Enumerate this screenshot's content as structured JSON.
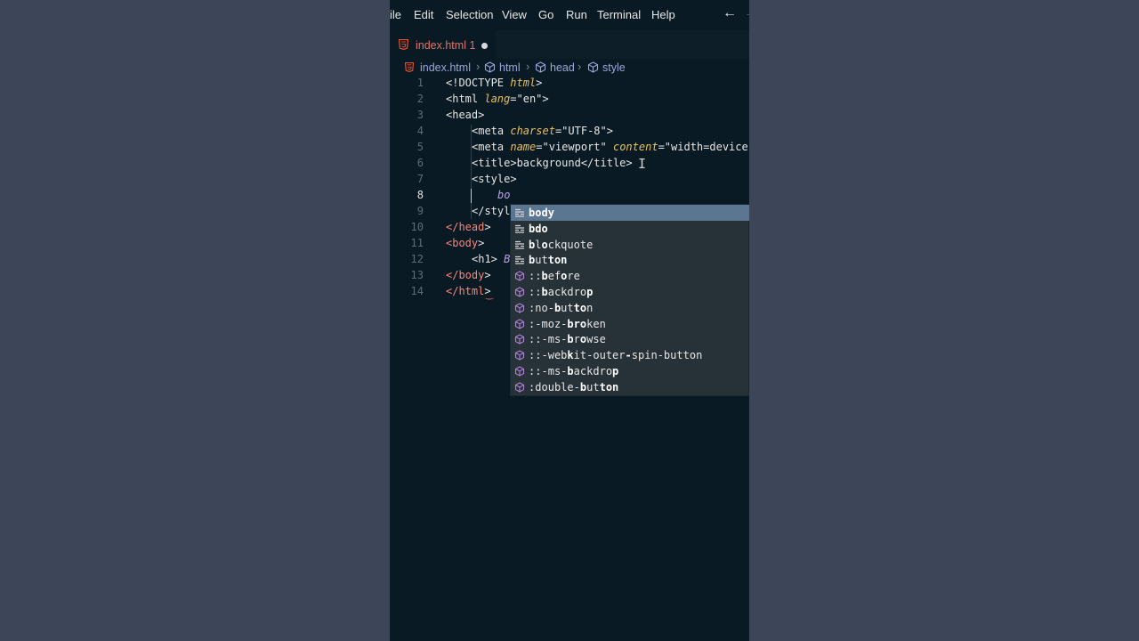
{
  "menubar": {
    "items": [
      "ile",
      "Edit",
      "Selection",
      "View",
      "Go",
      "Run",
      "Terminal",
      "Help"
    ]
  },
  "tab": {
    "label": "index.html 1"
  },
  "breadcrumb": {
    "file": "index.html",
    "items": [
      "html",
      "head",
      "style"
    ]
  },
  "editor": {
    "active_line": 8,
    "lines": [
      {
        "n": "1",
        "parts": [
          [
            "tag",
            "<!DOCTYPE "
          ],
          [
            "kw",
            "html"
          ],
          [
            "tag",
            ">"
          ]
        ],
        "indent": 0
      },
      {
        "n": "2",
        "parts": [
          [
            "tag",
            "<html "
          ],
          [
            "attr",
            "lang"
          ],
          [
            "tag",
            "="
          ],
          [
            "str",
            "\"en\""
          ],
          [
            "tag",
            ">"
          ]
        ],
        "indent": 0
      },
      {
        "n": "3",
        "parts": [
          [
            "tag",
            "<head>"
          ]
        ],
        "indent": 0
      },
      {
        "n": "4",
        "parts": [
          [
            "tag",
            "<meta "
          ],
          [
            "attr",
            "charset"
          ],
          [
            "tag",
            "="
          ],
          [
            "str",
            "\"UTF-8\""
          ],
          [
            "tag",
            ">"
          ]
        ],
        "indent": 1
      },
      {
        "n": "5",
        "parts": [
          [
            "tag",
            "<meta "
          ],
          [
            "attr",
            "name"
          ],
          [
            "tag",
            "="
          ],
          [
            "str",
            "\"viewport\" "
          ],
          [
            "attr",
            "content"
          ],
          [
            "tag",
            "="
          ],
          [
            "str",
            "\"width=device-"
          ]
        ],
        "indent": 1
      },
      {
        "n": "6",
        "parts": [
          [
            "tag",
            "<title>background</title>"
          ]
        ],
        "indent": 1
      },
      {
        "n": "7",
        "parts": [
          [
            "tag",
            "<style>"
          ]
        ],
        "indent": 1
      },
      {
        "n": "8",
        "parts": [
          [
            "typed",
            "bo"
          ]
        ],
        "indent": 2
      },
      {
        "n": "9",
        "parts": [
          [
            "tag",
            "</styl"
          ]
        ],
        "indent": 1
      },
      {
        "n": "10",
        "parts": [
          [
            "end",
            "</head"
          ],
          [
            "tag",
            ">"
          ]
        ],
        "indent": 0
      },
      {
        "n": "11",
        "parts": [
          [
            "end",
            "<body"
          ],
          [
            "tag",
            ">"
          ]
        ],
        "indent": 0
      },
      {
        "n": "12",
        "parts": [
          [
            "tag",
            "<h1> "
          ],
          [
            "typed",
            "B"
          ]
        ],
        "indent": 1
      },
      {
        "n": "13",
        "parts": [
          [
            "end",
            "</body"
          ],
          [
            "tag",
            ">"
          ]
        ],
        "indent": 0
      },
      {
        "n": "14",
        "parts": [
          [
            "end",
            "</html"
          ],
          [
            "tag",
            ">"
          ]
        ],
        "indent": 0
      }
    ]
  },
  "suggestions": [
    {
      "kind": "keyword",
      "label": "body",
      "match": [
        0,
        1,
        2,
        3
      ]
    },
    {
      "kind": "keyword",
      "label": "bdo",
      "match": [
        0,
        1,
        2
      ]
    },
    {
      "kind": "keyword",
      "label": "blockquote",
      "match": [
        0,
        2
      ]
    },
    {
      "kind": "keyword",
      "label": "button",
      "match": [
        0,
        3,
        4,
        5
      ]
    },
    {
      "kind": "module",
      "label": "::before",
      "match": [
        2,
        5
      ]
    },
    {
      "kind": "module",
      "label": "::backdrop",
      "match": [
        2,
        9
      ]
    },
    {
      "kind": "module",
      "label": ":no-button",
      "match": [
        4,
        7,
        8
      ]
    },
    {
      "kind": "module",
      "label": ":-moz-broken",
      "match": [
        6,
        7,
        8
      ]
    },
    {
      "kind": "module",
      "label": "::-ms-browse",
      "match": [
        6,
        8
      ]
    },
    {
      "kind": "module",
      "label": "::-webkit-outer-spin-button",
      "match": [
        6,
        15
      ]
    },
    {
      "kind": "module",
      "label": "::-ms-backdrop",
      "match": [
        6,
        13
      ]
    },
    {
      "kind": "module",
      "label": ":double-button",
      "match": [
        8,
        11,
        12,
        13
      ]
    }
  ],
  "colors": {
    "editor_bg": "#0a1a24",
    "suggest_bg": "#263238",
    "suggest_selected": "#5b7690",
    "html_icon": "#e44d26",
    "module_icon": "#b180d7",
    "keyword_icon": "#d4d4d4"
  }
}
